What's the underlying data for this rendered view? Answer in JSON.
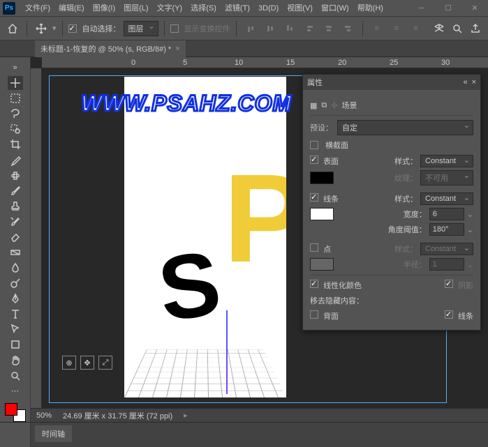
{
  "menu": [
    "文件(F)",
    "编辑(E)",
    "图像(I)",
    "图层(L)",
    "文字(Y)",
    "选择(S)",
    "滤镜(T)",
    "3D(D)",
    "视图(V)",
    "窗口(W)",
    "帮助(H)"
  ],
  "optionbar": {
    "auto_select_label": "自动选择：",
    "layer_dropdown": "图层",
    "show_transform": "显示变换控件"
  },
  "doc_tab": "未标题-1-恢复的 @ 50% (s, RGB/8#) *",
  "ruler_marks": [
    "0",
    "5",
    "10",
    "15",
    "20",
    "25",
    "30"
  ],
  "watermark": "WWW.PSAHZ.COM",
  "panel": {
    "title": "属性",
    "scene_label": "场景",
    "preset_label": "预设：",
    "preset_value": "自定",
    "cross_section": "横截面",
    "surface": "表面",
    "style_label": "样式：",
    "style_value": "Constant",
    "texture_label": "纹理：",
    "texture_value": "不可用",
    "lines": "线条",
    "width_label": "宽度：",
    "width_value": "6",
    "angle_label": "角度阈值：",
    "angle_value": "180°",
    "points": "点",
    "radius_label": "半径：",
    "radius_value": "1",
    "linearize": "线性化颜色",
    "shadow": "阴影",
    "remove_hidden": "移去隐藏内容：",
    "backface": "背面",
    "lines2": "线条"
  },
  "status": {
    "zoom": "50%",
    "dims": "24.69 厘米 x 31.75 厘米 (72 ppi)"
  },
  "timeline_tab": "时间轴",
  "colors": {
    "fg": "#ff0000",
    "bg": "#ffffff"
  }
}
